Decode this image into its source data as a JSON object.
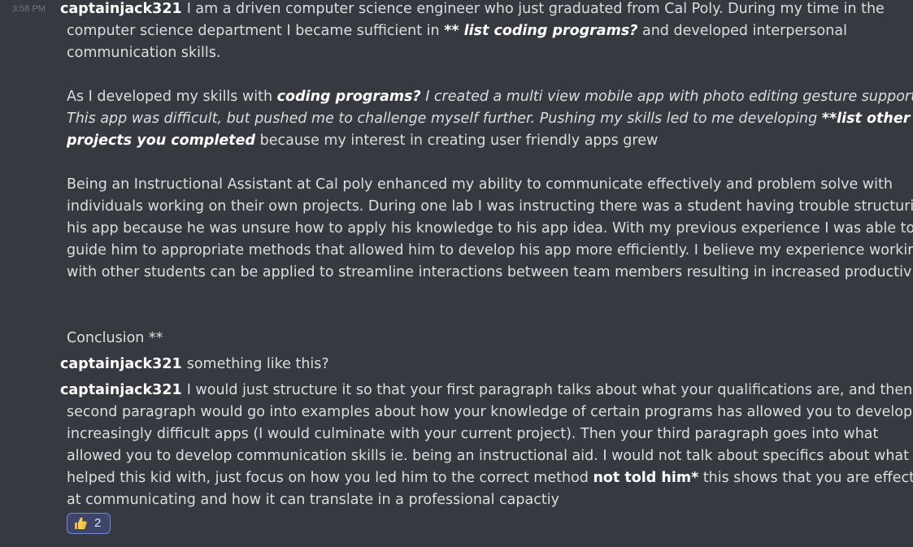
{
  "messages": [
    {
      "timestamp": "3:58 PM",
      "author": "captainjack321",
      "p1": {
        "l1_text": "I am a driven computer science engineer who just graduated from Cal Poly. During my time in the",
        "l2_a": "computer science department I became sufficient in ",
        "l2_b": "** list coding programs?",
        "l2_c": " and developed interpersonal",
        "l3": "communication skills."
      },
      "p2": {
        "l1_a": "As I developed my skills with ",
        "l1_b": "coding programs?",
        "l1_c": " I created a multi view mobile app with photo editing gesture support.",
        "l2_a": "This app was difficult, but pushed me to challenge myself further. Pushing my skills led to me developing ",
        "l2_b": "**list other",
        "l3_a": "projects you completed",
        "l3_b": " because my interest in creating user friendly apps grew"
      },
      "p3": {
        "l1": "Being an Instructional Assistant at Cal poly enhanced my ability to communicate effectively and problem solve with",
        "l2": "individuals working on their own projects. During one lab I was instructing there was a student having trouble structuring",
        "l3": "his app because he was unsure how to apply his knowledge to his app idea. With my previous experience I was able to",
        "l4": "guide him to appropriate methods that allowed him to develop his app more efficiently. I believe my experience working",
        "l5": "with other students can be applied to streamline interactions between team members resulting in increased productivity."
      },
      "conclusion": "Conclusion **"
    },
    {
      "author": "captainjack321",
      "text": "something like this?"
    },
    {
      "author": "captainjack321",
      "l1": "I would just structure it so that your first paragraph talks about what your qualifications are, and then your",
      "l2": "second paragraph would go into examples about how your knowledge of certain programs has allowed you to develop",
      "l3": "increasingly difficult apps (I would culminate with your current project). Then your third paragraph goes into what",
      "l4": "allowed you to develop communication skills ie. being an instructional aid. I would not talk about specifics about what you",
      "l5_a": "helped this kid with, just focus on how you led him to the correct method ",
      "l5_b": "not told him*",
      "l5_c": " this shows that you are effective",
      "l6": "at communicating and how it can translate in a professional capactiy",
      "reaction": {
        "emoji": "thumbs-up-icon",
        "count": "2"
      }
    }
  ],
  "colors": {
    "background": "#36393f",
    "text": "#dcddde",
    "username": "#ffffff",
    "timestamp": "#72767d",
    "reaction_bg": "#3f4469",
    "reaction_border": "#7289da"
  }
}
